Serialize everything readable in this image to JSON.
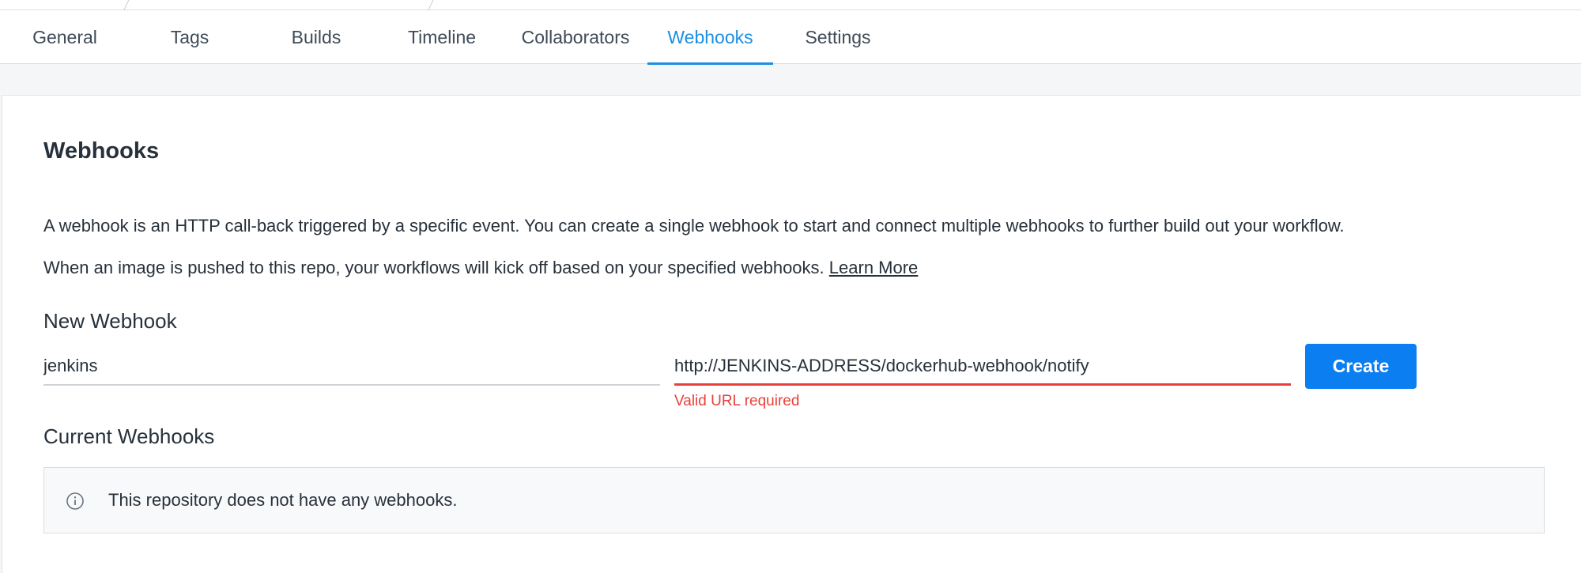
{
  "tabs": [
    {
      "label": "General",
      "active": false
    },
    {
      "label": "Tags",
      "active": false
    },
    {
      "label": "Builds",
      "active": false
    },
    {
      "label": "Timeline",
      "active": false
    },
    {
      "label": "Collaborators",
      "active": false
    },
    {
      "label": "Webhooks",
      "active": true
    },
    {
      "label": "Settings",
      "active": false
    }
  ],
  "section": {
    "title": "Webhooks",
    "description_line1": "A webhook is an HTTP call-back triggered by a specific event. You can create a single webhook to start and connect multiple webhooks to further build out your workflow.",
    "description_line2": "When an image is pushed to this repo, your workflows will kick off based on your specified webhooks.",
    "learn_more": "Learn More"
  },
  "new_webhook": {
    "heading": "New Webhook",
    "name_value": "jenkins",
    "url_value": "http://JENKINS-ADDRESS/dockerhub-webhook/notify",
    "url_error": "Valid URL required",
    "create_label": "Create"
  },
  "current_webhooks": {
    "heading": "Current Webhooks",
    "empty_message": "This repository does not have any webhooks.",
    "icon": "info-icon"
  },
  "colors": {
    "accent": "#1d8ee0",
    "button": "#0b7ef2",
    "error": "#e8413a"
  }
}
